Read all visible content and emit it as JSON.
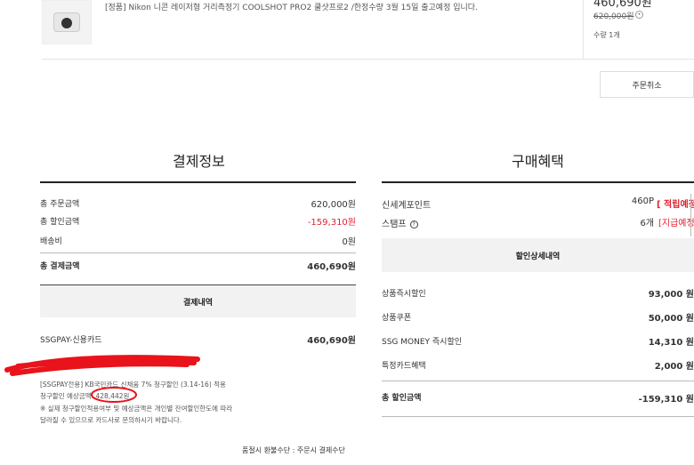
{
  "product": {
    "name": "[정품] Nikon 니콘 레이저형 거리측정기 COOLSHOT PRO2 쿨샷프로2 /한정수량 3월 15일 출고예정 입니다.",
    "sale_price": "460,690원",
    "original_price": "620,000원",
    "quantity": "수량 1개"
  },
  "cancel_button": "주문취소",
  "payment_info": {
    "title": "결제정보",
    "rows": [
      {
        "label": "총 주문금액",
        "value": "620,000원"
      },
      {
        "label": "총 할인금액",
        "value": "-159,310원"
      },
      {
        "label": "배송비",
        "value": "0원"
      }
    ],
    "total_label": "총 결제금액",
    "total_value": "460,690원",
    "details_header": "결제내역",
    "method_label": "SSGPAY-신용카드",
    "method_value": "460,690원",
    "notes": [
      "[SSGPAY전용] KB국민카드 신채움 7% 청구할인 (3.14-16) 적용",
      "청구할인 예상금액: 428,442원",
      "※ 실제 청구할인적용여부 및 예상금액은 개인별 잔여할인한도에 따라",
      "달라질 수 있으므로 카드사로 문의하시기 바랍니다."
    ],
    "refund_note": "품절시 환불수단 : 주문시 결제수단"
  },
  "benefits": {
    "title": "구매혜택",
    "points_label": "신세계포인트",
    "points_value": "460P",
    "points_status": "[ 적립예정",
    "stamp_label": "스탬프",
    "stamp_value": "6개",
    "stamp_status": "[지급예정",
    "discount_header": "할인상세내역",
    "discounts": [
      {
        "label": "상품즉시할인",
        "value": "93,000 원"
      },
      {
        "label": "상품쿠폰",
        "value": "50,000 원"
      },
      {
        "label": "SSG MONEY 즉시할인",
        "value": "14,310 원"
      },
      {
        "label": "특정카드혜택",
        "value": "2,000 원"
      }
    ],
    "total_label": "총 할인금액",
    "total_value": "-159,310 원"
  },
  "colors": {
    "accent_red": "#e3202e",
    "annotation_red": "#e8131b"
  }
}
